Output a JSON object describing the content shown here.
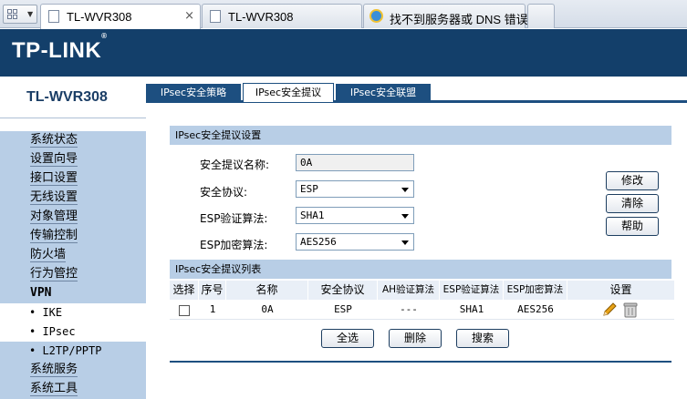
{
  "browser": {
    "tabs": [
      {
        "title": "TL-WVR308",
        "close": "×"
      },
      {
        "title": "TL-WVR308"
      },
      {
        "title": "找不到服务器或 DNS 错误"
      }
    ]
  },
  "header": {
    "logo": "TP-LINK",
    "logo_mark": "®"
  },
  "sidebar": {
    "model": "TL-WVR308",
    "items": [
      {
        "label": "系统状态"
      },
      {
        "label": "设置向导"
      },
      {
        "label": "接口设置"
      },
      {
        "label": "无线设置"
      },
      {
        "label": "对象管理"
      },
      {
        "label": "传输控制"
      },
      {
        "label": "防火墙"
      },
      {
        "label": "行为管控"
      },
      {
        "label": "VPN"
      },
      {
        "label": "• IKE"
      },
      {
        "label": "• IPsec"
      },
      {
        "label": "• L2TP/PPTP"
      },
      {
        "label": "系统服务"
      },
      {
        "label": "系统工具"
      }
    ]
  },
  "tabs": [
    {
      "label": "IPsec安全策略"
    },
    {
      "label": "IPsec安全提议"
    },
    {
      "label": "IPsec安全联盟"
    }
  ],
  "settings": {
    "section_title": "IPsec安全提议设置",
    "name_label": "安全提议名称:",
    "name_value": "0A",
    "protocol_label": "安全协议:",
    "protocol_value": "ESP",
    "esp_auth_label": "ESP验证算法:",
    "esp_auth_value": "SHA1",
    "esp_enc_label": "ESP加密算法:",
    "esp_enc_value": "AES256",
    "buttons": {
      "modify": "修改",
      "clear": "清除",
      "help": "帮助"
    }
  },
  "list": {
    "section_title": "IPsec安全提议列表",
    "columns": [
      "选择",
      "序号",
      "名称",
      "安全协议",
      "AH验证算法",
      "ESP验证算法",
      "ESP加密算法",
      "设置"
    ],
    "rows": [
      {
        "index": "1",
        "name": "0A",
        "protocol": "ESP",
        "ah_auth": "---",
        "esp_auth": "SHA1",
        "esp_enc": "AES256"
      }
    ],
    "buttons": {
      "select_all": "全选",
      "delete": "删除",
      "search": "搜索"
    }
  },
  "colors": {
    "header_bg": "#133f6a",
    "accent": "#1d4f80",
    "menu_bg": "#b8cee6"
  }
}
